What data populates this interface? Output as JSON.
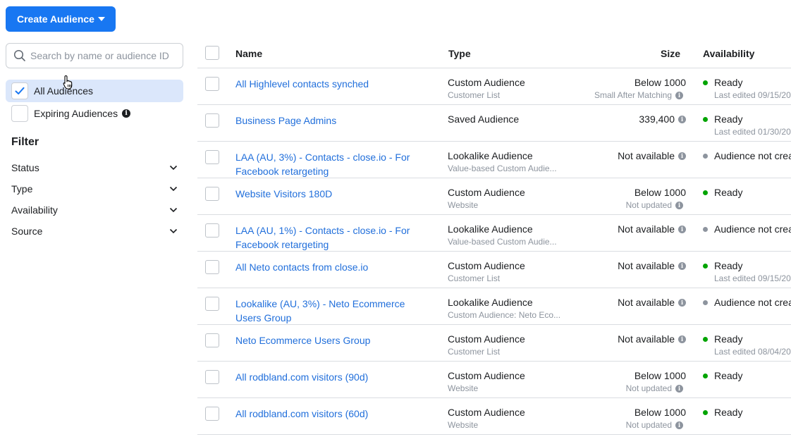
{
  "header": {
    "create_label": "Create Audience"
  },
  "search": {
    "placeholder": "Search by name or audience ID"
  },
  "sidebar": {
    "all_label": "All Audiences",
    "expiring_label": "Expiring Audiences",
    "filter_title": "Filter",
    "filters": [
      "Status",
      "Type",
      "Availability",
      "Source"
    ]
  },
  "table": {
    "headers": {
      "name": "Name",
      "type": "Type",
      "size": "Size",
      "availability": "Availability"
    },
    "rows": [
      {
        "name": "All Highlevel contacts synched",
        "type": "Custom Audience",
        "type_sub": "Customer List",
        "size": "Below 1000",
        "size_info": false,
        "size_sub": "Small After Matching",
        "status": "Ready",
        "status_color": "#00a400",
        "status_sub": "Last edited 09/15/20"
      },
      {
        "name": "Business Page Admins",
        "type": "Saved Audience",
        "type_sub": "",
        "size": "339,400",
        "size_info": true,
        "size_sub": "",
        "status": "Ready",
        "status_color": "#00a400",
        "status_sub": "Last edited 01/30/20"
      },
      {
        "name": "LAA (AU, 3%) - Contacts - close.io - For Facebook retargeting",
        "type": "Lookalike Audience",
        "type_sub": "Value-based Custom Audie...",
        "size": "Not available",
        "size_info": true,
        "size_sub": "",
        "status": "Audience not crea",
        "status_color": "#8d949e",
        "status_sub": ""
      },
      {
        "name": "Website Visitors 180D",
        "type": "Custom Audience",
        "type_sub": "Website",
        "size": "Below 1000",
        "size_info": false,
        "size_sub": "Not updated",
        "status": "Ready",
        "status_color": "#00a400",
        "status_sub": ""
      },
      {
        "name": "LAA (AU, 1%) - Contacts - close.io - For Facebook retargeting",
        "type": "Lookalike Audience",
        "type_sub": "Value-based Custom Audie...",
        "size": "Not available",
        "size_info": true,
        "size_sub": "",
        "status": "Audience not crea",
        "status_color": "#8d949e",
        "status_sub": ""
      },
      {
        "name": "All Neto contacts from close.io",
        "type": "Custom Audience",
        "type_sub": "Customer List",
        "size": "Not available",
        "size_info": true,
        "size_sub": "",
        "status": "Ready",
        "status_color": "#00a400",
        "status_sub": "Last edited 09/15/20"
      },
      {
        "name": "Lookalike (AU, 3%) - Neto Ecommerce Users Group",
        "type": "Lookalike Audience",
        "type_sub": "Custom Audience: Neto Eco...",
        "size": "Not available",
        "size_info": true,
        "size_sub": "",
        "status": "Audience not crea",
        "status_color": "#8d949e",
        "status_sub": ""
      },
      {
        "name": "Neto Ecommerce Users Group",
        "type": "Custom Audience",
        "type_sub": "Customer List",
        "size": "Not available",
        "size_info": true,
        "size_sub": "",
        "status": "Ready",
        "status_color": "#00a400",
        "status_sub": "Last edited 08/04/20"
      },
      {
        "name": "All rodbland.com visitors (90d)",
        "type": "Custom Audience",
        "type_sub": "Website",
        "size": "Below 1000",
        "size_info": false,
        "size_sub": "Not updated",
        "status": "Ready",
        "status_color": "#00a400",
        "status_sub": ""
      },
      {
        "name": "All rodbland.com visitors (60d)",
        "type": "Custom Audience",
        "type_sub": "Website",
        "size": "Below 1000",
        "size_info": false,
        "size_sub": "Not updated",
        "status": "Ready",
        "status_color": "#00a400",
        "status_sub": ""
      }
    ]
  },
  "icons": {
    "search": "search-icon",
    "info": "info-icon",
    "chevron": "chevron-down-icon",
    "check": "checkmark-icon",
    "cursor": "hand-pointer-cursor-icon"
  },
  "colors": {
    "accent": "#1877f2",
    "link": "#216fdb",
    "ready": "#00a400",
    "unavailable": "#8d949e",
    "selected_bg": "#dbe7fb"
  }
}
